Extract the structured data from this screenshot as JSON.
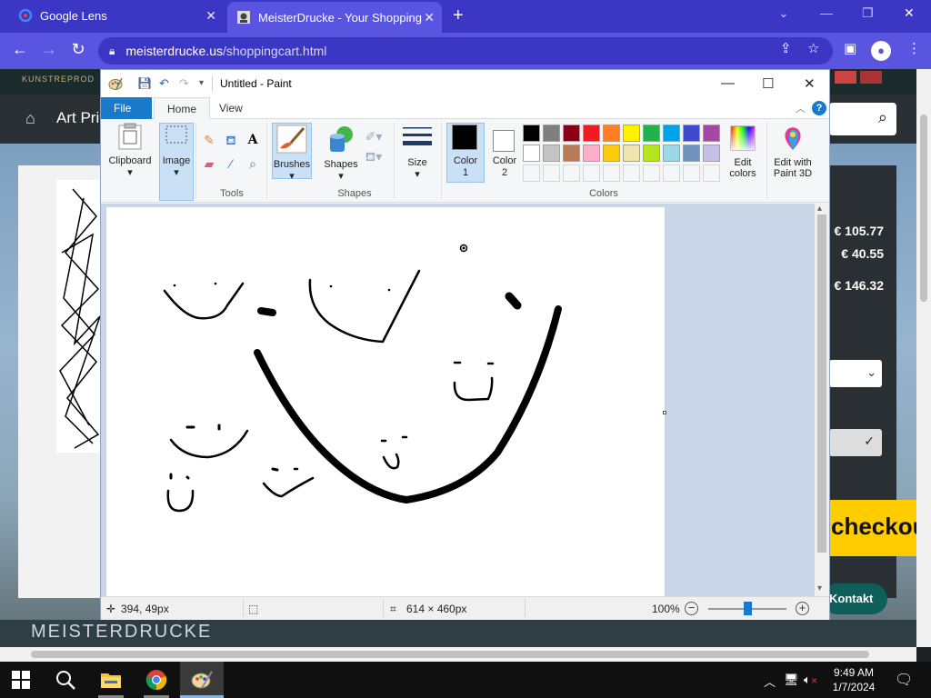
{
  "browser": {
    "tabs": [
      {
        "title": "Google Lens",
        "close": "✕"
      },
      {
        "title": "MeisterDrucke - Your Shopping",
        "close": "✕"
      }
    ],
    "new_tab": "+",
    "url_host": "meisterdrucke.us",
    "url_path": "/shoppingcart.html"
  },
  "website": {
    "logo_text": "KUNSTREPROD",
    "nav_label": "Art Pri",
    "prices": [
      "€ 105.77",
      "€ 40.55",
      "€ 146.32"
    ],
    "checkout_label": "checkou",
    "contact_label": "Kontakt",
    "footer_text": "MEISTERDRUCKE"
  },
  "paint": {
    "title": "Untitled - Paint",
    "tabs": {
      "file": "File",
      "home": "Home",
      "view": "View"
    },
    "help": "?",
    "ribbon": {
      "clipboard": "Clipboard",
      "image": "Image",
      "tools_group": "Tools",
      "brushes": "Brushes",
      "shapes": "Shapes",
      "shapes_group": "Shapes",
      "size": "Size",
      "color1_line1": "Color",
      "color1_line2": "1",
      "color2_line1": "Color",
      "color2_line2": "2",
      "colors_group": "Colors",
      "edit_colors_line1": "Edit",
      "edit_colors_line2": "colors",
      "edit_3d_line1": "Edit with",
      "edit_3d_line2": "Paint 3D"
    },
    "palette_row1": [
      "#000000",
      "#7f7f7f",
      "#880015",
      "#ed1c24",
      "#ff7f27",
      "#fff200",
      "#22b14c",
      "#00a2e8",
      "#3f48cc",
      "#a349a4"
    ],
    "palette_row2": [
      "#ffffff",
      "#c3c3c3",
      "#b97a57",
      "#ffaec9",
      "#ffc90e",
      "#efe4b0",
      "#b5e61d",
      "#99d9ea",
      "#7092be",
      "#c8bfe7"
    ],
    "color1": "#000000",
    "color2": "#ffffff",
    "status": {
      "cursor_pos": "394, 49px",
      "canvas_size": "614 × 460px",
      "zoom": "100%"
    }
  },
  "taskbar": {
    "time": "9:49 AM",
    "date": "1/7/2024"
  },
  "icons": [
    "google-lens-icon",
    "meisterdrucke-favicon",
    "back-icon",
    "forward-icon",
    "reload-icon",
    "lock-icon",
    "share-icon",
    "star-icon",
    "sidebar-icon",
    "profile-icon",
    "menu-icon",
    "paint-icon",
    "save-icon",
    "undo-icon",
    "redo-icon",
    "windows-start-icon",
    "search-icon",
    "file-explorer-icon",
    "chrome-icon",
    "network-icon",
    "volume-icon",
    "notification-icon"
  ]
}
